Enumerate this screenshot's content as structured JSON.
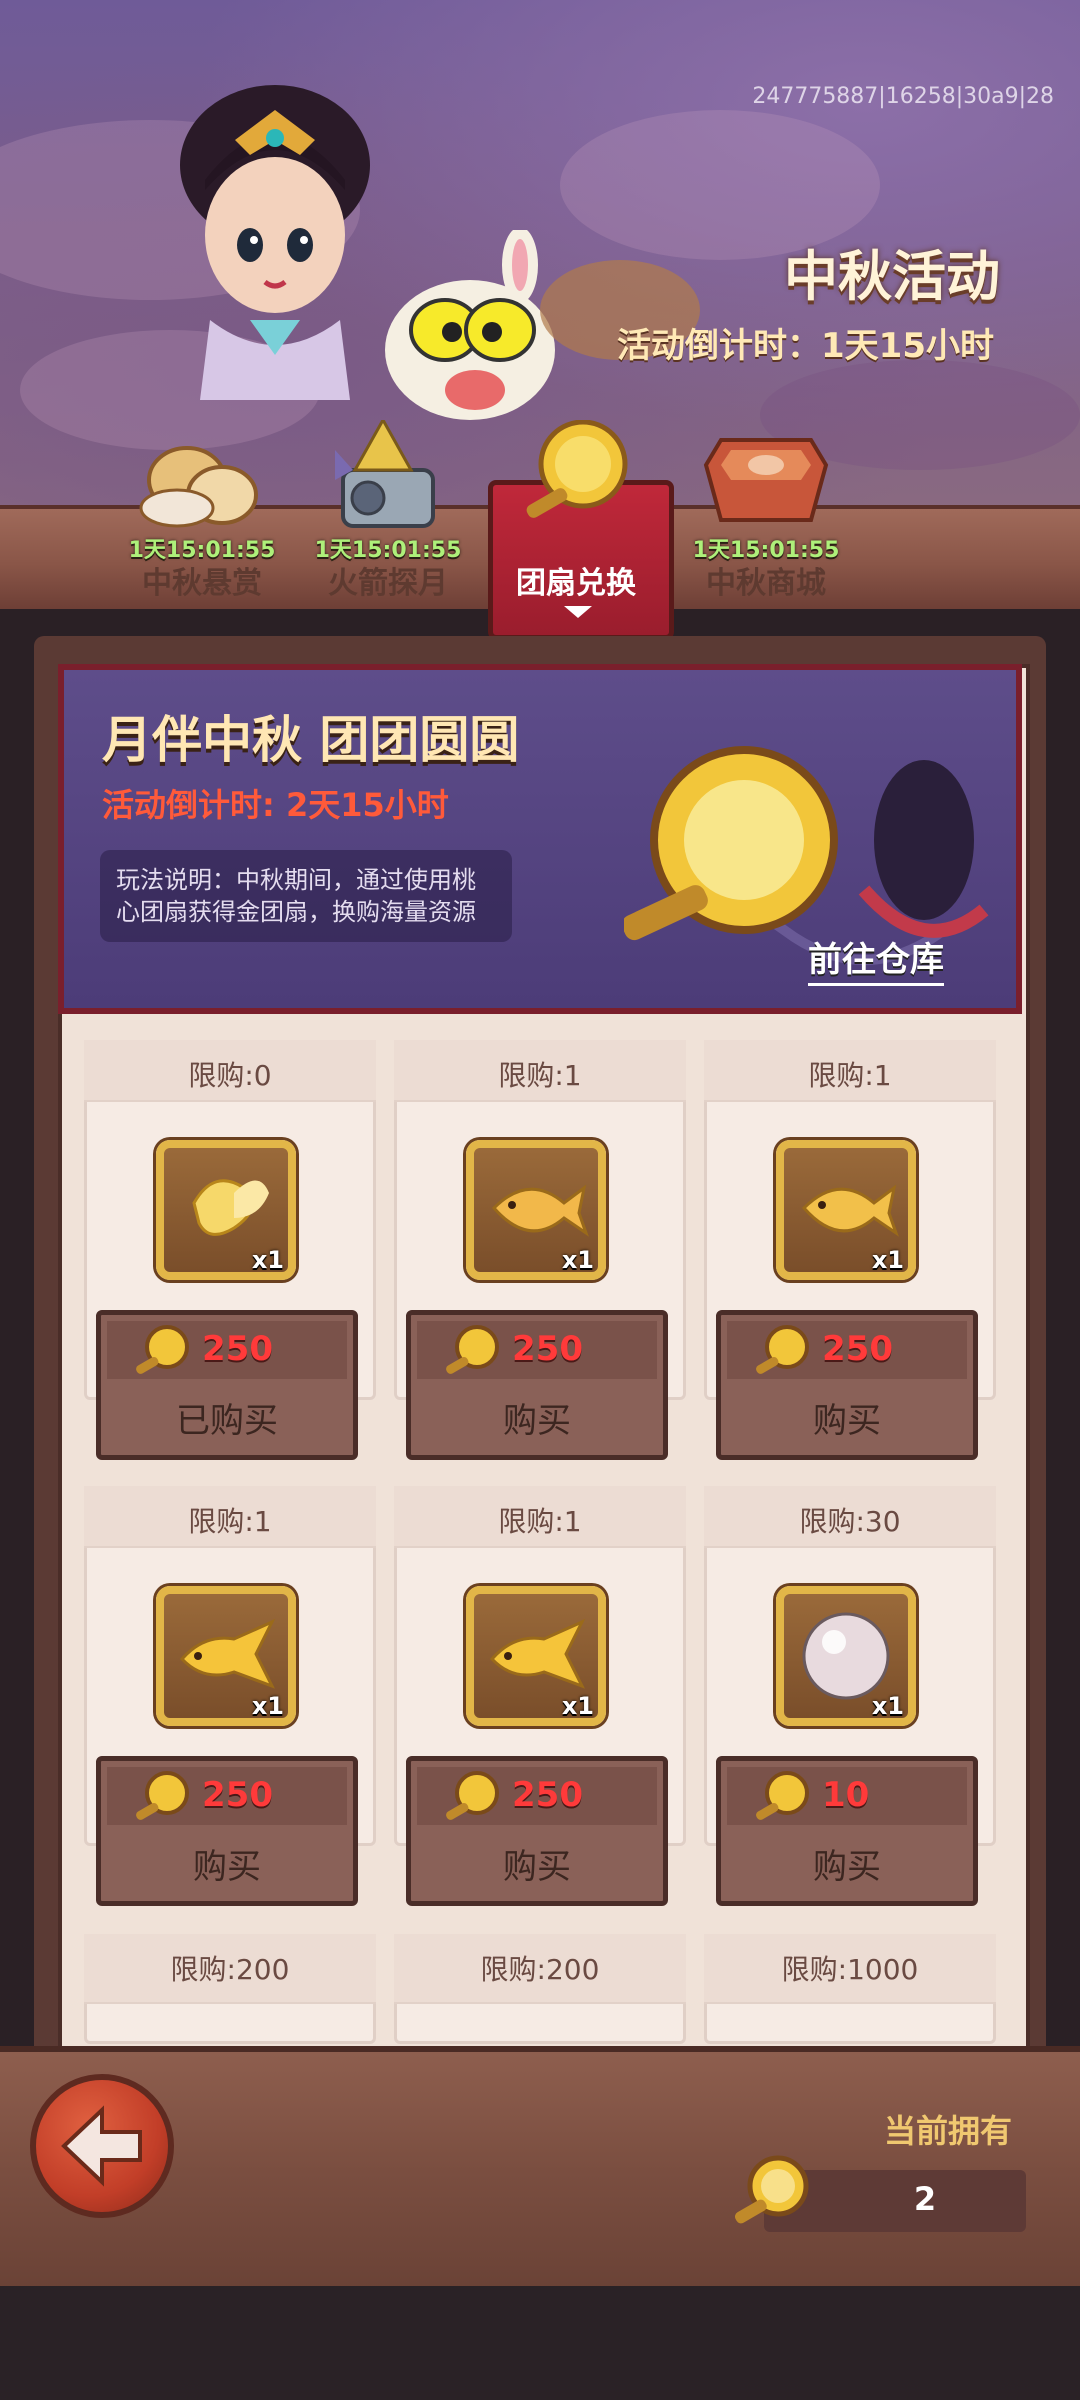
{
  "header": {
    "uid": "247775887|16258|30a9|28",
    "title": "中秋活动",
    "countdown": "活动倒计时：1天15小时"
  },
  "tabs": [
    {
      "label": "中秋悬赏",
      "timer": "1天15:01:55",
      "icon": "mooncake-cloud-icon"
    },
    {
      "label": "火箭探月",
      "timer": "1天15:01:55",
      "icon": "rocket-icon"
    },
    {
      "label": "团扇兑换",
      "timer": "",
      "icon": "golden-fan-icon",
      "active": true
    },
    {
      "label": "中秋商城",
      "timer": "1天15:01:55",
      "icon": "gift-box-icon"
    }
  ],
  "event": {
    "title": "月伴中秋 团团圆圆",
    "countdown": "活动倒计时: 2天15小时",
    "description": "玩法说明：中秋期间，通过使用桃心团扇获得金团扇，换购海量资源",
    "goto_label": "前往仓库"
  },
  "items": [
    {
      "limit": "限购:0",
      "qty": "x1",
      "price": "250",
      "button": "已购买",
      "icon": "betta-fish-icon"
    },
    {
      "limit": "限购:1",
      "qty": "x1",
      "price": "250",
      "button": "购买",
      "icon": "goldfish-icon"
    },
    {
      "limit": "限购:1",
      "qty": "x1",
      "price": "250",
      "button": "购买",
      "icon": "goldfish-icon"
    },
    {
      "limit": "限购:1",
      "qty": "x1",
      "price": "250",
      "button": "购买",
      "icon": "golden-fish-icon"
    },
    {
      "limit": "限购:1",
      "qty": "x1",
      "price": "250",
      "button": "购买",
      "icon": "golden-fish-icon"
    },
    {
      "limit": "限购:30",
      "qty": "x1",
      "price": "10",
      "button": "购买",
      "icon": "pearl-icon"
    },
    {
      "limit": "限购:200"
    },
    {
      "limit": "限购:200"
    },
    {
      "limit": "限购:1000"
    }
  ],
  "footer": {
    "owned_label": "当前拥有",
    "owned_value": "2"
  },
  "colors": {
    "price_red": "#ff3a3a",
    "timer_green": "#aef07a",
    "active_tab_red": "#c0283a"
  }
}
